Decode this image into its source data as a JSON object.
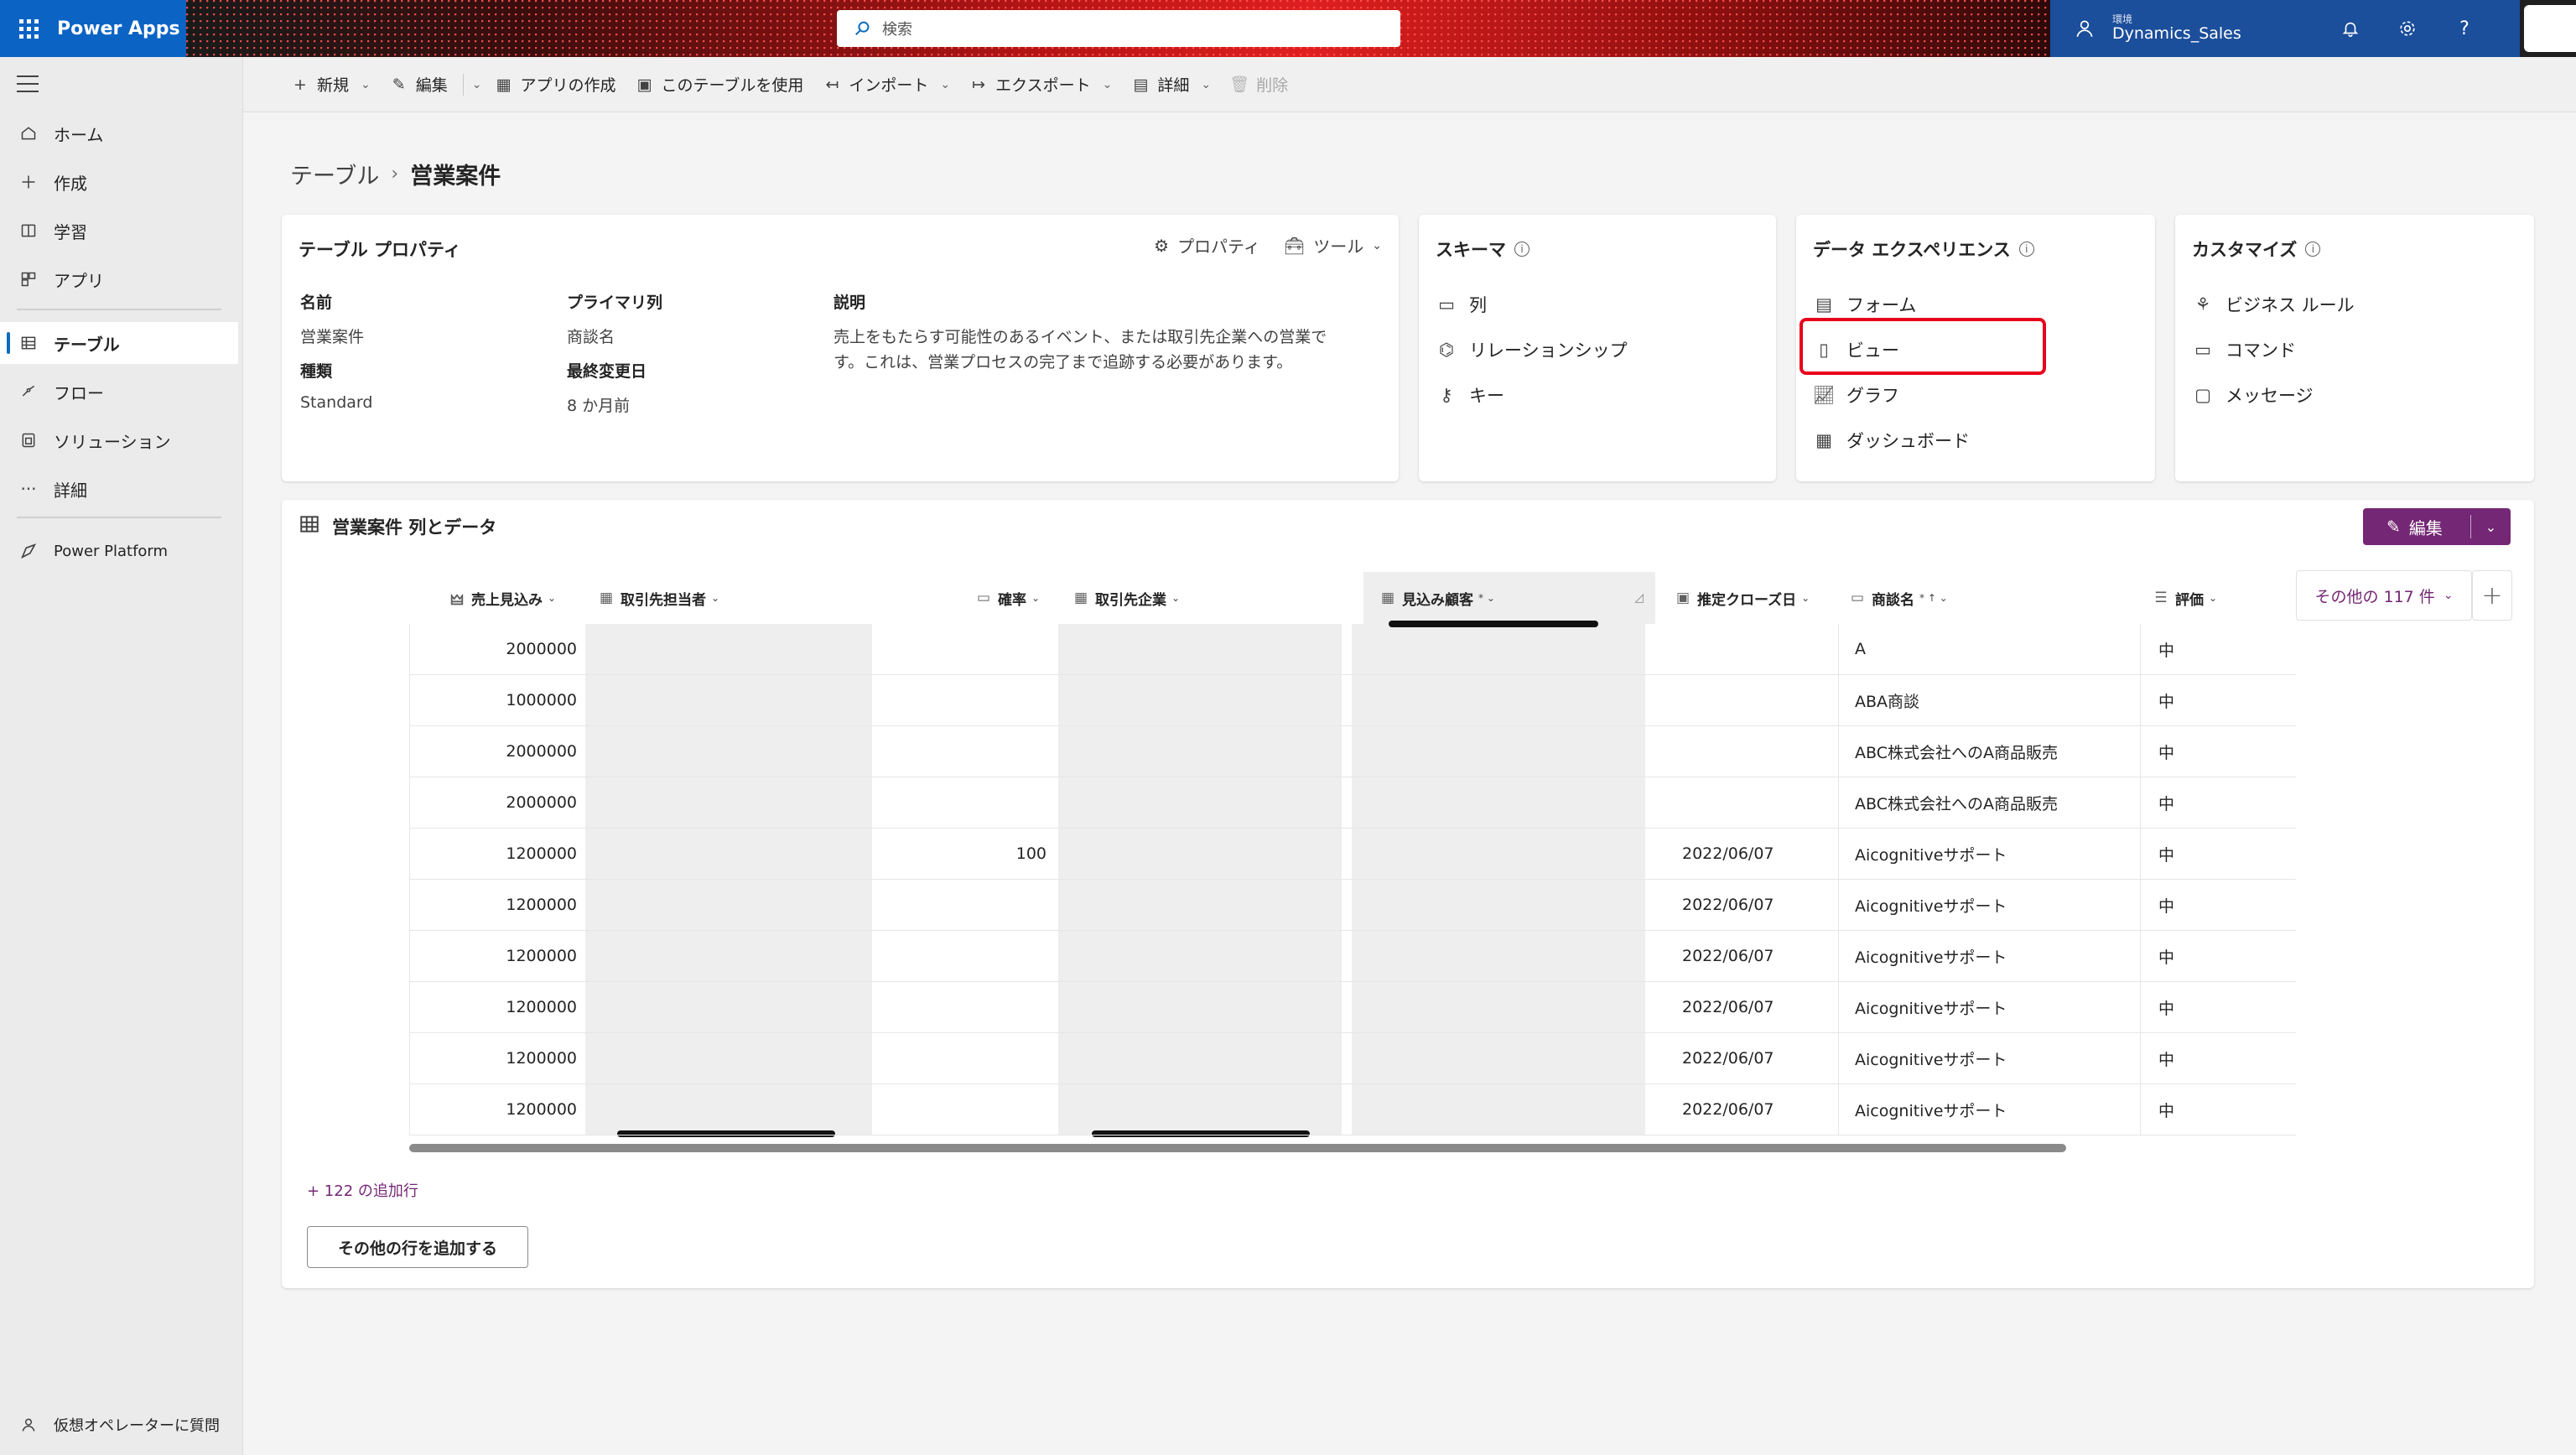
{
  "topbar": {
    "app_name": "Power Apps",
    "search_placeholder": "検索",
    "env_label": "環境",
    "env_name": "Dynamics_Sales"
  },
  "leftnav": {
    "items": [
      {
        "label": "ホーム",
        "icon": "home-icon"
      },
      {
        "label": "作成",
        "icon": "plus-icon"
      },
      {
        "label": "学習",
        "icon": "book-icon"
      },
      {
        "label": "アプリ",
        "icon": "apps-icon"
      },
      {
        "label": "テーブル",
        "icon": "table-icon"
      },
      {
        "label": "フロー",
        "icon": "flow-icon"
      },
      {
        "label": "ソリューション",
        "icon": "solution-icon"
      },
      {
        "label": "詳細",
        "icon": "more-icon"
      },
      {
        "label": "Power Platform",
        "icon": "power-platform-icon"
      }
    ],
    "bottom": "仮想オペレーターに質問"
  },
  "cmdbar": {
    "new": "新規",
    "edit": "編集",
    "create_app": "アプリの作成",
    "use_table": "このテーブルを使用",
    "import": "インポート",
    "export": "エクスポート",
    "details": "詳細",
    "delete": "削除"
  },
  "breadcrumb": {
    "root": "テーブル",
    "current": "営業案件"
  },
  "table_properties": {
    "title": "テーブル プロパティ",
    "properties_action": "プロパティ",
    "tools_action": "ツール",
    "name_label": "名前",
    "name_value": "営業案件",
    "type_label": "種類",
    "type_value": "Standard",
    "primary_col_label": "プライマリ列",
    "primary_col_value": "商談名",
    "modified_label": "最終変更日",
    "modified_value": "8 か月前",
    "desc_label": "説明",
    "desc_value": "売上をもたらす可能性のあるイベント、または取引先企業への営業です。これは、営業プロセスの完了まで追跡する必要があります。"
  },
  "schema": {
    "title": "スキーマ",
    "links": [
      "列",
      "リレーションシップ",
      "キー"
    ]
  },
  "data_experience": {
    "title": "データ エクスペリエンス",
    "links": [
      "フォーム",
      "ビュー",
      "グラフ",
      "ダッシュボード"
    ]
  },
  "customize": {
    "title": "カスタマイズ",
    "links": [
      "ビジネス ルール",
      "コマンド",
      "メッセージ"
    ]
  },
  "data_section": {
    "title": "営業案件 列とデータ",
    "edit_label": "編集",
    "columns": [
      "売上見込み",
      "取引先担当者",
      "確率",
      "取引先企業",
      "見込み顧客",
      "推定クローズ日",
      "商談名",
      "評価"
    ],
    "more_columns": "その他の 117 件",
    "rows": [
      {
        "revenue": "2000000",
        "probability": "",
        "close_date": "",
        "name": "A",
        "rating": "中"
      },
      {
        "revenue": "1000000",
        "probability": "",
        "close_date": "",
        "name": "ABA商談",
        "rating": "中"
      },
      {
        "revenue": "2000000",
        "probability": "",
        "close_date": "",
        "name": "ABC株式会社へのA商品販売",
        "rating": "中"
      },
      {
        "revenue": "2000000",
        "probability": "",
        "close_date": "",
        "name": "ABC株式会社へのA商品販売",
        "rating": "中"
      },
      {
        "revenue": "1200000",
        "probability": "100",
        "close_date": "2022/06/07",
        "name": "Aicognitiveサポート",
        "rating": "中"
      },
      {
        "revenue": "1200000",
        "probability": "",
        "close_date": "2022/06/07",
        "name": "Aicognitiveサポート",
        "rating": "中"
      },
      {
        "revenue": "1200000",
        "probability": "",
        "close_date": "2022/06/07",
        "name": "Aicognitiveサポート",
        "rating": "中"
      },
      {
        "revenue": "1200000",
        "probability": "",
        "close_date": "2022/06/07",
        "name": "Aicognitiveサポート",
        "rating": "中"
      },
      {
        "revenue": "1200000",
        "probability": "",
        "close_date": "2022/06/07",
        "name": "Aicognitiveサポート",
        "rating": "中"
      },
      {
        "revenue": "1200000",
        "probability": "",
        "close_date": "2022/06/07",
        "name": "Aicognitiveサポート",
        "rating": "中"
      }
    ],
    "more_rows": "+ 122 の追加行",
    "load_more": "その他の行を追加する"
  },
  "colors": {
    "brand_blue": "#0b63c4",
    "accent_purple": "#742774",
    "highlight_red": "#e8001c"
  }
}
